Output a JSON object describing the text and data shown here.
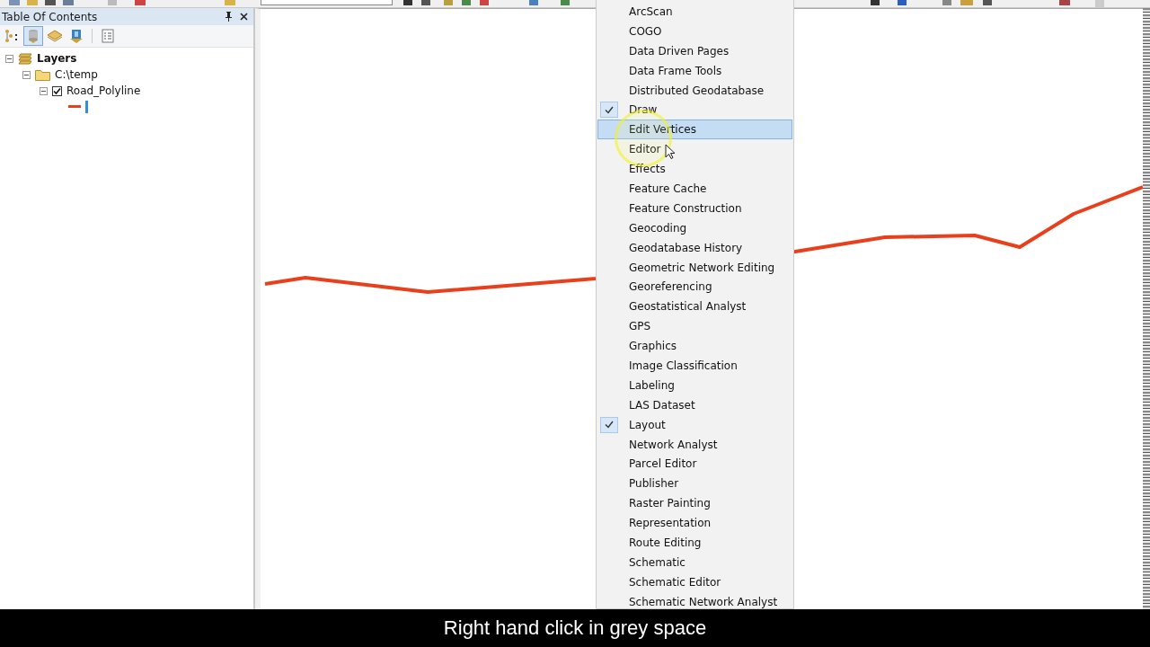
{
  "toc": {
    "title": "Table Of Contents",
    "tools": [
      {
        "kind": "drawing-order",
        "selected": false
      },
      {
        "kind": "source",
        "selected": true
      },
      {
        "kind": "visibility",
        "selected": false
      },
      {
        "kind": "selection",
        "selected": false
      },
      {
        "kind": "options",
        "selected": false
      }
    ],
    "tree": [
      {
        "label": "Layers",
        "kind": "frame",
        "expanded": true,
        "children": [
          {
            "label": "C:\\temp",
            "kind": "folder",
            "expanded": true,
            "children": [
              {
                "label": "Road_Polyline",
                "kind": "layer",
                "expanded": true,
                "checked": true
              }
            ]
          }
        ]
      }
    ]
  },
  "menu": [
    {
      "label": "ArcScan",
      "checked": false,
      "selected": false
    },
    {
      "label": "COGO",
      "checked": false,
      "selected": false
    },
    {
      "label": "Data Driven Pages",
      "checked": false,
      "selected": false
    },
    {
      "label": "Data Frame Tools",
      "checked": false,
      "selected": false
    },
    {
      "label": "Distributed Geodatabase",
      "checked": false,
      "selected": false
    },
    {
      "label": "Draw",
      "checked": true,
      "selected": false
    },
    {
      "label": "Edit Vertices",
      "checked": false,
      "selected": true
    },
    {
      "label": "Editor",
      "checked": false,
      "selected": false
    },
    {
      "label": "Effects",
      "checked": false,
      "selected": false
    },
    {
      "label": "Feature Cache",
      "checked": false,
      "selected": false
    },
    {
      "label": "Feature Construction",
      "checked": false,
      "selected": false
    },
    {
      "label": "Geocoding",
      "checked": false,
      "selected": false
    },
    {
      "label": "Geodatabase History",
      "checked": false,
      "selected": false
    },
    {
      "label": "Geometric Network Editing",
      "checked": false,
      "selected": false
    },
    {
      "label": "Georeferencing",
      "checked": false,
      "selected": false
    },
    {
      "label": "Geostatistical Analyst",
      "checked": false,
      "selected": false
    },
    {
      "label": "GPS",
      "checked": false,
      "selected": false
    },
    {
      "label": "Graphics",
      "checked": false,
      "selected": false
    },
    {
      "label": "Image Classification",
      "checked": false,
      "selected": false
    },
    {
      "label": "Labeling",
      "checked": false,
      "selected": false
    },
    {
      "label": "LAS Dataset",
      "checked": false,
      "selected": false
    },
    {
      "label": "Layout",
      "checked": true,
      "selected": false
    },
    {
      "label": "Network Analyst",
      "checked": false,
      "selected": false
    },
    {
      "label": "Parcel Editor",
      "checked": false,
      "selected": false
    },
    {
      "label": "Publisher",
      "checked": false,
      "selected": false
    },
    {
      "label": "Raster Painting",
      "checked": false,
      "selected": false
    },
    {
      "label": "Representation",
      "checked": false,
      "selected": false
    },
    {
      "label": "Route Editing",
      "checked": false,
      "selected": false
    },
    {
      "label": "Schematic",
      "checked": false,
      "selected": false
    },
    {
      "label": "Schematic Editor",
      "checked": false,
      "selected": false
    },
    {
      "label": "Schematic Network Analyst",
      "checked": false,
      "selected": false
    }
  ],
  "caption": "Right hand click in grey space"
}
